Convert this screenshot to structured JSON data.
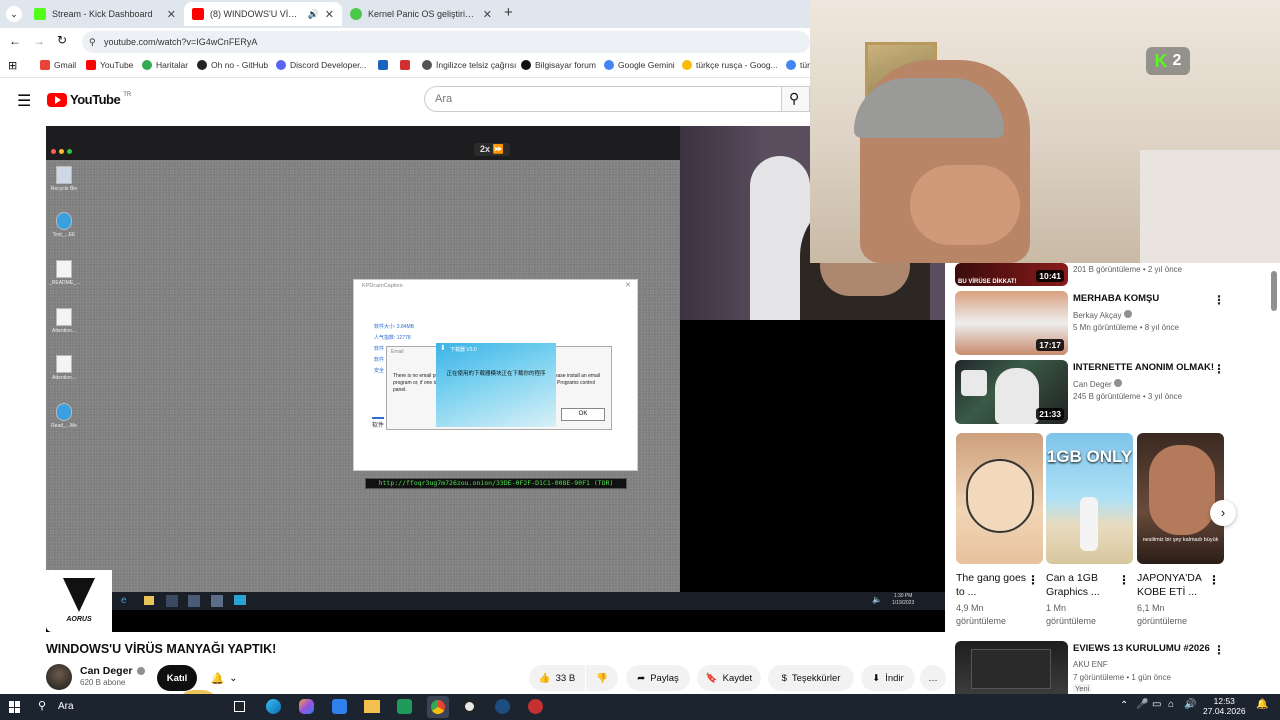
{
  "browser": {
    "tabs": [
      {
        "label": "Stream - Kick Dashboard"
      },
      {
        "label": "(8) WINDOWS'U VİRÜS MA"
      },
      {
        "label": "Kernel Panic OS geliştiriyor |"
      }
    ],
    "url": "youtube.com/watch?v=IG4wCnFERyA",
    "bookmarks": [
      "Gmail",
      "YouTube",
      "Haritalar",
      "Oh no - GitHub",
      "Discord Developer...",
      "İngilizce telsiz çağrısı",
      "Bilgisayar forum",
      "Google Gemini",
      "türkçe rusça - Goog...",
      "türk"
    ]
  },
  "youtube": {
    "logo": "YouTube",
    "logo_region": "TR",
    "search_placeholder": "Ara"
  },
  "video": {
    "speed_badge": "2x",
    "dialog_title": "KPDcamCaption",
    "dialog_lines": [
      "软件大小: 3.84MB",
      "人气指数: 12778",
      "软件",
      "软件",
      "安全"
    ],
    "dialog_bottom": "软件",
    "email_title": "Email",
    "email_text": "There is no email program associated to perform the requested action. Please install an email program or, if one is already installed, create an association in the Default Programs control panel.",
    "popup_title": "下载器 V3.0",
    "popup_text": "正在使用的下载器模块正在下载你的程序",
    "ok_label": "OK",
    "tor_url": "http://ffoqr3ug7m726zou.onion/33DE-0F2F-D1C1-008E-90F1 (TOR)",
    "desktop_icons": [
      "Recycle Bin",
      "Test_...EE",
      "_README_...",
      "Attention...",
      "Attention...",
      "Read_...Me"
    ],
    "clock_time": "1:30 PM",
    "clock_date": "1/19/2023",
    "channel_watermark": "AORUS"
  },
  "stream_overlay": {
    "badge_letter": "K",
    "badge_count": "2"
  },
  "below_video": {
    "title": "WINDOWS'U VİRÜS MANYAĞI YAPTIK!",
    "channel": "Can Deger",
    "subs": "620 B abone",
    "join": "Katıl",
    "likes": "33 B",
    "share": "Paylaş",
    "save": "Kaydet",
    "thanks": "Teşekkürler",
    "download": "İndir",
    "more": "…"
  },
  "sidebar": {
    "top_partial": {
      "duration": "10:41",
      "meta": "201 B görüntüleme • 2 yıl önce",
      "thumb_text": "BU VİRÜSE DİKKAT!"
    },
    "recs": [
      {
        "title": "MERHABA KOMŞU",
        "channel": "Berkay Akçay",
        "meta": "5 Mn görüntüleme • 8 yıl önce",
        "duration": "17:17"
      },
      {
        "title": "INTERNETTE ANONIM OLMAK!",
        "channel": "Can Deger",
        "meta": "245 B görüntüleme • 3 yıl önce",
        "duration": "21:33"
      }
    ],
    "shorts": [
      {
        "title": "The gang goes to ...",
        "views": "4,9 Mn görüntüleme"
      },
      {
        "title": "Can a 1GB Graphics ...",
        "views": "1 Mn görüntüleme",
        "overlay": "1GB ONLY"
      },
      {
        "title": "JAPONYA'DA KOBE ETİ ...",
        "views": "6,1 Mn görüntüleme",
        "overlay": "nesilimiz bir şey kalmadı büyük"
      }
    ],
    "last_rec": {
      "title": "EVIEWS 13 KURULUMU #2026",
      "channel": "AKU ENF",
      "meta": "7 görüntüleme • 1 gün önce",
      "badge": "Yeni"
    }
  },
  "taskbar": {
    "search": "Ara",
    "time": "12:53",
    "date": "27.04.2026"
  },
  "colors": {
    "yt_red": "#ff0000",
    "kick_green": "#53fc18",
    "chrome_tab_bg": "#dfe6ee"
  }
}
